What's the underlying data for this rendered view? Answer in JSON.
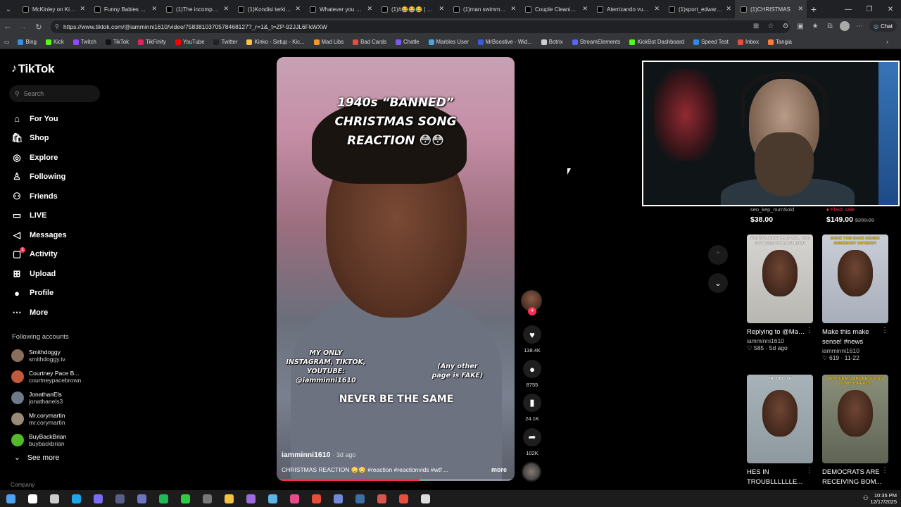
{
  "browser": {
    "tabs": [
      {
        "label": "McKinley on Kick (8"
      },
      {
        "label": "Funny Babies Being"
      },
      {
        "label": "(1)The incompetenc"
      },
      {
        "label": "(1)Kondisi terkini m"
      },
      {
        "label": "Whatever you do \" I"
      },
      {
        "label": "(1)#😂😂😂 | Funn"
      },
      {
        "label": "(1)man swimming in"
      },
      {
        "label": "Couple Cleaning Fa"
      },
      {
        "label": "Aterrizando vuelos"
      },
      {
        "label": "(1)sport_edward_06"
      },
      {
        "label": "(1)CHRISTMAS"
      }
    ],
    "active_tab_index": 10,
    "url": "https://www.tiktok.com/@iamminni1610/video/7583810370578468127?_r=1&_t=ZP-92JJL6FkWXW",
    "chat_label": "Chat",
    "bookmarks": [
      {
        "label": "Bing",
        "color": "#3a8de0"
      },
      {
        "label": "Kick",
        "color": "#53fc18"
      },
      {
        "label": "Twitch",
        "color": "#9146ff"
      },
      {
        "label": "TikTok",
        "color": "#111111"
      },
      {
        "label": "TikFinity",
        "color": "#e0245e"
      },
      {
        "label": "YouTube",
        "color": "#ff0000"
      },
      {
        "label": "Twitter",
        "color": "#222222"
      },
      {
        "label": "Kinko - Setup - Kic...",
        "color": "#f4c542"
      },
      {
        "label": "Mad Libs",
        "color": "#f19a2b"
      },
      {
        "label": "Bad Cards",
        "color": "#e74c3c"
      },
      {
        "label": "Chatle",
        "color": "#7b5ce3"
      },
      {
        "label": "Marbles User",
        "color": "#4aa3df"
      },
      {
        "label": "MrBoostive - Wid...",
        "color": "#3b5bdb"
      },
      {
        "label": "Botrix",
        "color": "#cfcfcf"
      },
      {
        "label": "StreamElements",
        "color": "#5865f2"
      },
      {
        "label": "KickBot Dashboard",
        "color": "#53fc18"
      },
      {
        "label": "Speed Test",
        "color": "#2b8be5"
      },
      {
        "label": "Inbox",
        "color": "#e74c3c"
      },
      {
        "label": "Tangia",
        "color": "#ff7a3c"
      }
    ]
  },
  "sidebar": {
    "brand": "TikTok",
    "search_placeholder": "Search",
    "nav": [
      {
        "label": "For You",
        "icon": "home-icon"
      },
      {
        "label": "Shop",
        "icon": "shop-icon"
      },
      {
        "label": "Explore",
        "icon": "compass-icon"
      },
      {
        "label": "Following",
        "icon": "following-icon"
      },
      {
        "label": "Friends",
        "icon": "friends-icon"
      },
      {
        "label": "LIVE",
        "icon": "live-icon"
      },
      {
        "label": "Messages",
        "icon": "messages-icon"
      },
      {
        "label": "Activity",
        "icon": "activity-icon"
      },
      {
        "label": "Upload",
        "icon": "upload-icon"
      },
      {
        "label": "Profile",
        "icon": "profile-icon"
      },
      {
        "label": "More",
        "icon": "more-icon"
      }
    ],
    "activity_badge": "1",
    "following_title": "Following accounts",
    "following": [
      {
        "name": "Smithdoggy",
        "handle": "smithdoggy.tv",
        "color": "#8a6d5a"
      },
      {
        "name": "Courtney Pace B...",
        "handle": "courtneypacebrown",
        "color": "#c05a3c"
      },
      {
        "name": "JonathanEls",
        "handle": "jonathanels3",
        "color": "#6c7a89"
      },
      {
        "name": "Mr.corymartin",
        "handle": "mr.corymartin",
        "color": "#9a8a76"
      },
      {
        "name": "BuyBackBrian",
        "handle": "buybackbrian",
        "color": "#53b82c"
      }
    ],
    "see_more": "See more",
    "company": "Company"
  },
  "video": {
    "title_line1": "1940s “BANNED”",
    "title_line2": "CHRISTMAS SONG",
    "title_line3": "REACTION 😳😳",
    "caption_left": "MY ONLY\nINSTAGRAM, TIKTOK,\nYOUTUBE:\n@iamminni1610",
    "caption_right": "(Any other\npage is FAKE)",
    "lower_text": "NEVER BE THE SAME",
    "author": "iamminni1610",
    "ago": "· 3d ago",
    "description": "CHRISTMAS REACTION 😳😳 #reaction #reactionvids #wtf ...",
    "more_label": "more",
    "progress": 0.6
  },
  "actions": {
    "likes": "138.4K",
    "comments": "8755",
    "saves": "24.1K",
    "shares": "102K"
  },
  "products": [
    {
      "label": "seo_kep_numSold",
      "price": "$38.00",
      "old": ""
    },
    {
      "label": "Flash sale",
      "price": "$149.00",
      "old": "$299.99"
    }
  ],
  "related": [
    {
      "title": "Replying to @Maggie OK MI...",
      "title2": "",
      "author": "iamminni1610",
      "stats": "♡ 585 · 5d ago",
      "overlay": "Y'KNOW MORE THAN ME... YOU GOT LESS THAN AN HOUR"
    },
    {
      "title": "Make this make",
      "title2": "sense! #news",
      "author": "iamminni1610",
      "stats": "♡ 619 · 11-22",
      "overlay": "MAKE THIS MAKE SENSE! SOMEBODY ANYBODY"
    },
    {
      "title": "HES IN",
      "title2": "TROUBLLLLLLE...",
      "author": "",
      "stats": "",
      "overlay": "TROUBLLLE"
    },
    {
      "title": "DEMOCRATS ARE",
      "title2": "RECEIVING BOM...",
      "author": "",
      "stats": "",
      "overlay": "DEMOCRATS ARE RECEIVING BOMB THREATS!"
    }
  ],
  "taskbar": {
    "time": "10:35 PM",
    "date": "12/17/2025",
    "apps": [
      {
        "name": "windows-start-icon",
        "color": "#4ea3f0"
      },
      {
        "name": "search-icon",
        "color": "#ffffff"
      },
      {
        "name": "task-view-icon",
        "color": "#cccccc"
      },
      {
        "name": "edge-icon",
        "color": "#1fa4e8"
      },
      {
        "name": "chrome-icon",
        "color": "#7b6cf2"
      },
      {
        "name": "app-icon-1",
        "color": "#555f8a"
      },
      {
        "name": "app-icon-2",
        "color": "#6a75c4"
      },
      {
        "name": "spotify-icon",
        "color": "#1db954"
      },
      {
        "name": "app-icon-3",
        "color": "#2ecc40"
      },
      {
        "name": "app-icon-4",
        "color": "#777777"
      },
      {
        "name": "folder-icon",
        "color": "#f3c242"
      },
      {
        "name": "app-icon-5",
        "color": "#9c6ade"
      },
      {
        "name": "app-icon-6",
        "color": "#5bb3e6"
      },
      {
        "name": "app-icon-7",
        "color": "#e94a8a"
      },
      {
        "name": "app-icon-8",
        "color": "#e74c3c"
      },
      {
        "name": "app-icon-9",
        "color": "#7289da"
      },
      {
        "name": "app-icon-10",
        "color": "#3a6ea5"
      },
      {
        "name": "app-icon-11",
        "color": "#d9534f"
      },
      {
        "name": "app-icon-12",
        "color": "#e74c3c"
      },
      {
        "name": "settings-icon",
        "color": "#dddddd"
      }
    ]
  }
}
